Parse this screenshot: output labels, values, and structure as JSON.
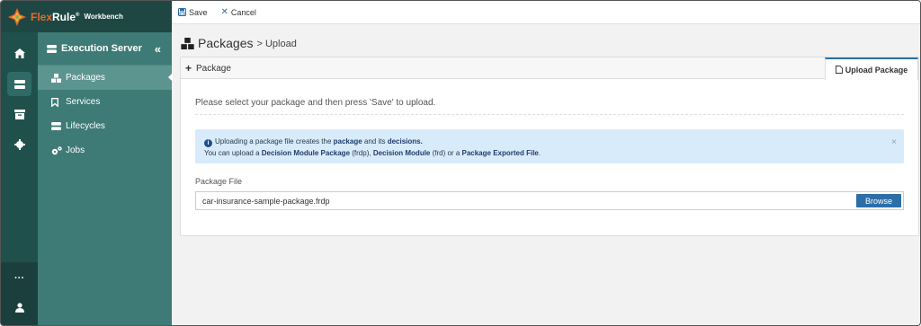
{
  "brand": {
    "name_prefix": "Flex",
    "name_suffix": "Rule",
    "reg": "®",
    "subtitle": "Workbench",
    "colors": {
      "accent": "#e86a2a"
    }
  },
  "rail": {
    "items": [
      "home-icon",
      "server-icon",
      "archive-icon",
      "gear-icon"
    ],
    "bottom": [
      "more-icon",
      "user-icon"
    ],
    "more_label": "···"
  },
  "subnav": {
    "title": "Execution Server",
    "collapse": "«",
    "items": [
      {
        "label": "Packages",
        "icon": "cubes-icon"
      },
      {
        "label": "Services",
        "icon": "bookmark-icon"
      },
      {
        "label": "Lifecycles",
        "icon": "server-icon"
      },
      {
        "label": "Jobs",
        "icon": "cogs-icon"
      }
    ]
  },
  "toolbar": {
    "save_label": "Save",
    "cancel_label": "Cancel"
  },
  "page": {
    "title": "Packages",
    "crumb": "> Upload"
  },
  "tabs": {
    "add_label": "Package",
    "upload_label": "Upload Package"
  },
  "content": {
    "instruction": "Please select your package and then press 'Save' to upload.",
    "alert": {
      "line1_pre": "Uploading a package file creates the ",
      "line1_b1": "package",
      "line1_mid": " and its ",
      "line1_b2": "decisions.",
      "line2_pre": "You can upload a ",
      "line2_b1": "Decision Module Package",
      "line2_m1": " (frdp), ",
      "line2_b2": "Decision Module",
      "line2_m2": " (frd) or a ",
      "line2_b3": "Package Exported File",
      "line2_end": ".",
      "close": "×"
    },
    "field_label": "Package File",
    "file_value": "car-insurance-sample-package.frdp",
    "browse_label": "Browse"
  }
}
